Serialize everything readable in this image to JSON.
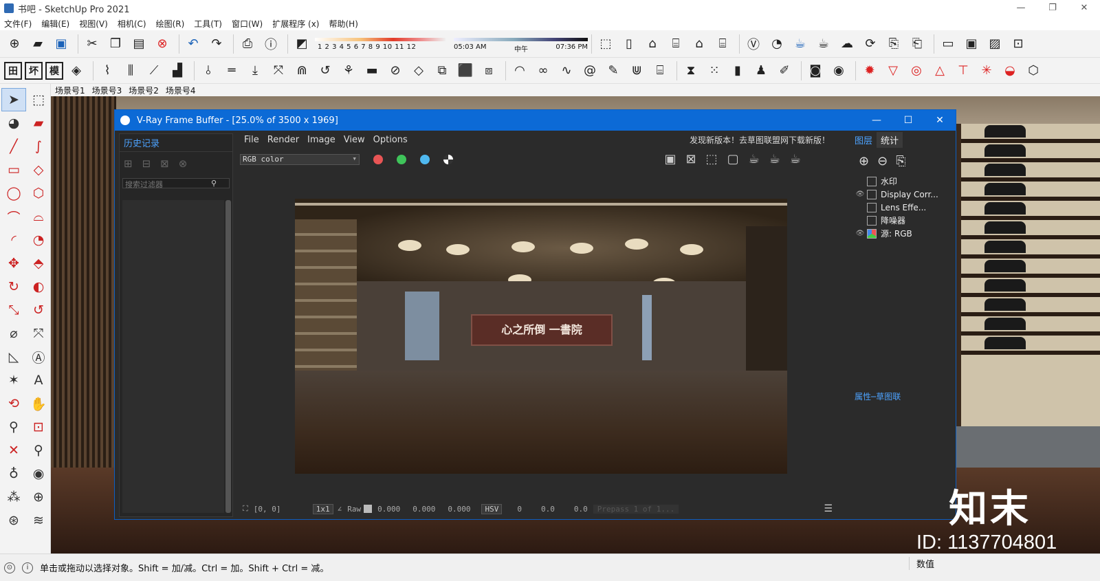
{
  "window": {
    "title": "书吧 - SketchUp Pro 2021",
    "minimize": "—",
    "restore": "❐",
    "close": "✕"
  },
  "menu": [
    "文件(F)",
    "编辑(E)",
    "视图(V)",
    "相机(C)",
    "绘图(R)",
    "工具(T)",
    "窗口(W)",
    "扩展程序 (x)",
    "帮助(H)"
  ],
  "shadow_settings": {
    "months": "1  2  3  4  5  6  7  8  9  10 11 12",
    "time_start": "05:03 AM",
    "time_mid": "中午",
    "time_end": "07:36 PM"
  },
  "toolbar2_labels": [
    "田",
    "坏",
    "模"
  ],
  "scene_tabs": [
    "场景号1",
    "场景号3",
    "场景号2",
    "场景号4"
  ],
  "vfb": {
    "title": "V-Ray Frame Buffer - [25.0% of 3500 x 1969]",
    "history_title": "历史记录",
    "search_placeholder": "搜索过滤器",
    "menu": [
      "File",
      "Render",
      "Image",
      "View",
      "Options"
    ],
    "update_notice": "发现新版本！去草图联盟网下载新版！",
    "channel": "RGB color",
    "channel_colors": {
      "red": "#e85555",
      "green": "#3fc45a",
      "blue": "#4fb8ef"
    },
    "render_sign": "心之所倒 一書院",
    "bottom": {
      "coords": "[0,  0]",
      "zoom": "1x1",
      "raw_label": "Raw",
      "r": "0.000",
      "g": "0.000",
      "b": "0.000",
      "color_mode": "HSV",
      "h": "0",
      "s": "0.0",
      "v": "0.0",
      "pass": "Prepass 1 of 1..."
    },
    "layers_tab": "图层",
    "stats_tab": "统计",
    "layers": [
      {
        "label": "水印",
        "eye": false
      },
      {
        "label": "Display Corr...",
        "eye": true
      },
      {
        "label": "Lens Effe...",
        "eye": false
      },
      {
        "label": "降噪器",
        "eye": false
      },
      {
        "label": "源: RGB",
        "eye": true
      }
    ],
    "properties_label": "属性─草图联"
  },
  "watermark": {
    "logo": "知末",
    "id": "ID: 1137704801"
  },
  "status": {
    "message": "单击或拖动以选择对象。Shift = 加/减。Ctrl = 加。Shift + Ctrl = 减。",
    "value_label": "数值"
  }
}
